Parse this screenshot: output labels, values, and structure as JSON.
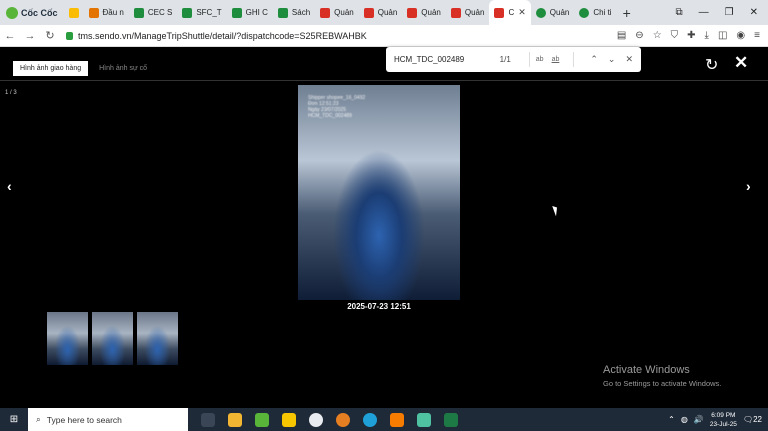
{
  "browser": {
    "brand_label": "Cốc Cốc",
    "tabs": [
      {
        "label": "Đầu n",
        "color": "#e37400"
      },
      {
        "label": "CEC S",
        "color": "#1e8e3e"
      },
      {
        "label": "SFC_T",
        "color": "#1e8e3e"
      },
      {
        "label": "GHI C",
        "color": "#1e8e3e"
      },
      {
        "label": "Sách",
        "color": "#1e8e3e"
      },
      {
        "label": "Quản",
        "color": "#d93025"
      },
      {
        "label": "Quản",
        "color": "#d93025"
      },
      {
        "label": "Quản",
        "color": "#d93025"
      },
      {
        "label": "Quản",
        "color": "#d93025"
      },
      {
        "label": "C",
        "color": "#d93025"
      },
      {
        "label": "Quản",
        "color": "#1e8e3e"
      },
      {
        "label": "Chi ti",
        "color": "#1e8e3e"
      }
    ],
    "url": "tms.sendo.vn/ManageTripShuttle/detail/?dispatchcode=S25REBWAHBK"
  },
  "find": {
    "query": "HCM_TDC_002489",
    "count": "1/1",
    "opt_case": "ab",
    "opt_word": "ab"
  },
  "page": {
    "tabs": [
      "Hình ảnh giao hàng",
      "Hình ảnh sự cố"
    ],
    "counter": "1 / 3",
    "caption": "2025-07-23 12:51",
    "stamp_lines": [
      "Shipper shopee_16_0492",
      "Đơn 12:51:23",
      "Ngày 23/07/2025",
      "HCM_TDC_002489"
    ]
  },
  "watermark": {
    "title": "Activate Windows",
    "subtitle": "Go to Settings to activate Windows."
  },
  "taskbar": {
    "search_placeholder": "Type here to search",
    "time": "6:09 PM",
    "date": "23-Jul-25",
    "notification_count": "22"
  }
}
